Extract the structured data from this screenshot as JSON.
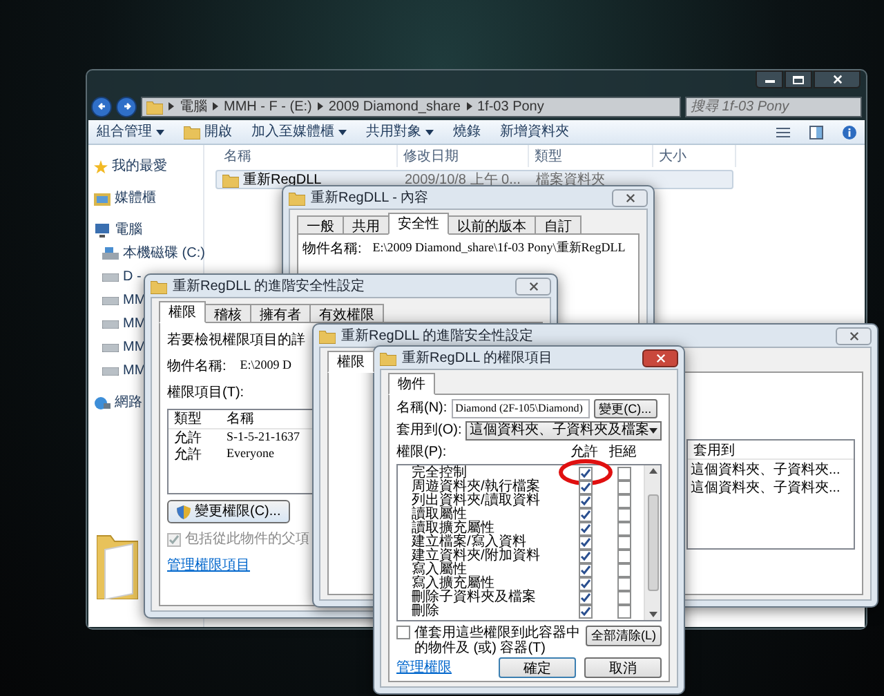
{
  "explorer": {
    "breadcrumb": [
      "電腦",
      "MMH - F - (E:)",
      "2009 Diamond_share",
      "1f-03 Pony"
    ],
    "search": {
      "placeholder": "搜尋 1f-03 Pony"
    },
    "toolbar": [
      {
        "label": "組合管理",
        "menu": true
      },
      {
        "label": "開啟",
        "menu": false
      },
      {
        "label": "加入至媒體櫃",
        "menu": true
      },
      {
        "label": "共用對象",
        "menu": true
      },
      {
        "label": "燒錄",
        "menu": false
      },
      {
        "label": "新增資料夾",
        "menu": false
      }
    ],
    "sidebar": [
      {
        "label": "我的最愛",
        "kind": "favorites"
      },
      {
        "label": "媒體櫃",
        "kind": "library"
      },
      {
        "label": "電腦",
        "kind": "computer",
        "children": [
          {
            "label": "本機磁碟 (C:)",
            "kind": "disk"
          },
          {
            "label": "D -",
            "kind": "drive"
          },
          {
            "label": "MM",
            "kind": "drive"
          },
          {
            "label": "MM",
            "kind": "drive"
          },
          {
            "label": "MM",
            "kind": "drive"
          },
          {
            "label": "MM",
            "kind": "drive"
          }
        ]
      },
      {
        "label": "網路",
        "kind": "network"
      }
    ],
    "columns": [
      "名稱",
      "修改日期",
      "類型",
      "大小"
    ],
    "files": [
      {
        "name": "重新RegDLL",
        "modified": "2009/10/8 上午 0...",
        "type": "檔案資料夾",
        "selected": true
      }
    ]
  },
  "properties": {
    "title": "重新RegDLL - 內容",
    "tabs": [
      {
        "label": "一般",
        "selected": false
      },
      {
        "label": "共用",
        "selected": false
      },
      {
        "label": "安全性",
        "selected": true
      },
      {
        "label": "以前的版本",
        "selected": false
      },
      {
        "label": "自訂",
        "selected": false
      }
    ],
    "object_label": "物件名稱:",
    "object_value": "E:\\2009 Diamond_share\\1f-03 Pony\\重新RegDLL"
  },
  "advanced": {
    "title": "重新RegDLL 的進階安全性設定",
    "tabs": [
      {
        "label": "權限",
        "selected": true
      },
      {
        "label": "稽核",
        "selected": false
      },
      {
        "label": "擁有者",
        "selected": false
      },
      {
        "label": "有效權限",
        "selected": false
      }
    ],
    "intro": "若要檢視權限項目的詳",
    "object_label": "物件名稱:",
    "object_value": "E:\\2009 D",
    "entries_label": "權限項目(T):",
    "columns": [
      "類型",
      "名稱"
    ],
    "rows": [
      [
        "允許",
        "S-1-5-21-1637"
      ],
      [
        "允許",
        "Everyone"
      ]
    ],
    "change_button": "變更權限(C)...",
    "inherit": {
      "label": "包括從此物件的父項",
      "checked": true,
      "disabled": true
    },
    "manage_link": "管理權限項目"
  },
  "advanced2": {
    "title": "重新RegDLL 的進階安全性設定",
    "tabs": [
      {
        "label": "權限",
        "selected": true
      }
    ],
    "columns": [
      "套用到"
    ],
    "rows": [
      "這個資料夾、子資料夾...",
      "這個資料夾、子資料夾..."
    ]
  },
  "entry": {
    "title": "重新RegDLL 的權限項目",
    "tabs": [
      {
        "label": "物件",
        "selected": true
      }
    ],
    "name_label": "名稱(N):",
    "name_value": "Diamond (2F-105\\Diamond)",
    "change_button": "變更(C)...",
    "apply_label": "套用到(O):",
    "apply_value": "這個資料夾、子資料夾及檔案",
    "permissions_label": "權限(P):",
    "columns": [
      "允許",
      "拒絕"
    ],
    "permissions": [
      {
        "label": "完全控制",
        "allow": true,
        "deny": false,
        "annotated": true
      },
      {
        "label": "周遊資料夾/執行檔案",
        "allow": true,
        "deny": false,
        "annotated": false
      },
      {
        "label": "列出資料夾/讀取資料",
        "allow": true,
        "deny": false,
        "annotated": false
      },
      {
        "label": "讀取屬性",
        "allow": true,
        "deny": false,
        "annotated": false
      },
      {
        "label": "讀取擴充屬性",
        "allow": true,
        "deny": false,
        "annotated": false
      },
      {
        "label": "建立檔案/寫入資料",
        "allow": true,
        "deny": false,
        "annotated": false
      },
      {
        "label": "建立資料夾/附加資料",
        "allow": true,
        "deny": false,
        "annotated": false
      },
      {
        "label": "寫入屬性",
        "allow": true,
        "deny": false,
        "annotated": false
      },
      {
        "label": "寫入擴充屬性",
        "allow": true,
        "deny": false,
        "annotated": false
      },
      {
        "label": "刪除子資料夾及檔案",
        "allow": true,
        "deny": false,
        "annotated": false
      },
      {
        "label": "刪除",
        "allow": true,
        "deny": false,
        "annotated": false
      }
    ],
    "only_apply": {
      "label": "僅套用這些權限到此容器中的物件及 (或) 容器(T)",
      "checked": false
    },
    "clear_button": "全部清除(L)",
    "manage_link": "管理權限",
    "buttons": [
      "確定",
      "取消"
    ]
  }
}
